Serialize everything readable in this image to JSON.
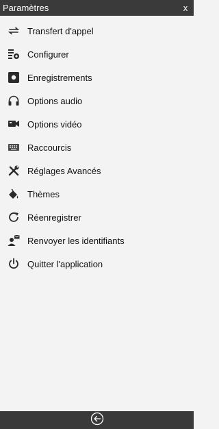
{
  "header": {
    "title": "Paramètres",
    "close_label": "x"
  },
  "menu": {
    "items": [
      {
        "label": "Transfert d'appel",
        "icon": "call-transfer-icon"
      },
      {
        "label": "Configurer",
        "icon": "configure-icon"
      },
      {
        "label": "Enregistrements",
        "icon": "recordings-icon"
      },
      {
        "label": "Options audio",
        "icon": "headphones-icon"
      },
      {
        "label": "Options vidéo",
        "icon": "video-camera-icon"
      },
      {
        "label": "Raccourcis",
        "icon": "keyboard-icon"
      },
      {
        "label": "Réglages Avancés",
        "icon": "tools-icon"
      },
      {
        "label": "Thèmes",
        "icon": "paint-bucket-icon"
      },
      {
        "label": "Réenregistrer",
        "icon": "refresh-icon"
      },
      {
        "label": "Renvoyer les identifiants",
        "icon": "user-mail-icon"
      },
      {
        "label": "Quitter l'application",
        "icon": "power-icon"
      }
    ]
  },
  "footer": {
    "back_icon": "back-arrow-icon"
  },
  "colors": {
    "bar": "#3a3a3a",
    "background": "#f3f3f3",
    "icon": "#2b2b2b"
  }
}
